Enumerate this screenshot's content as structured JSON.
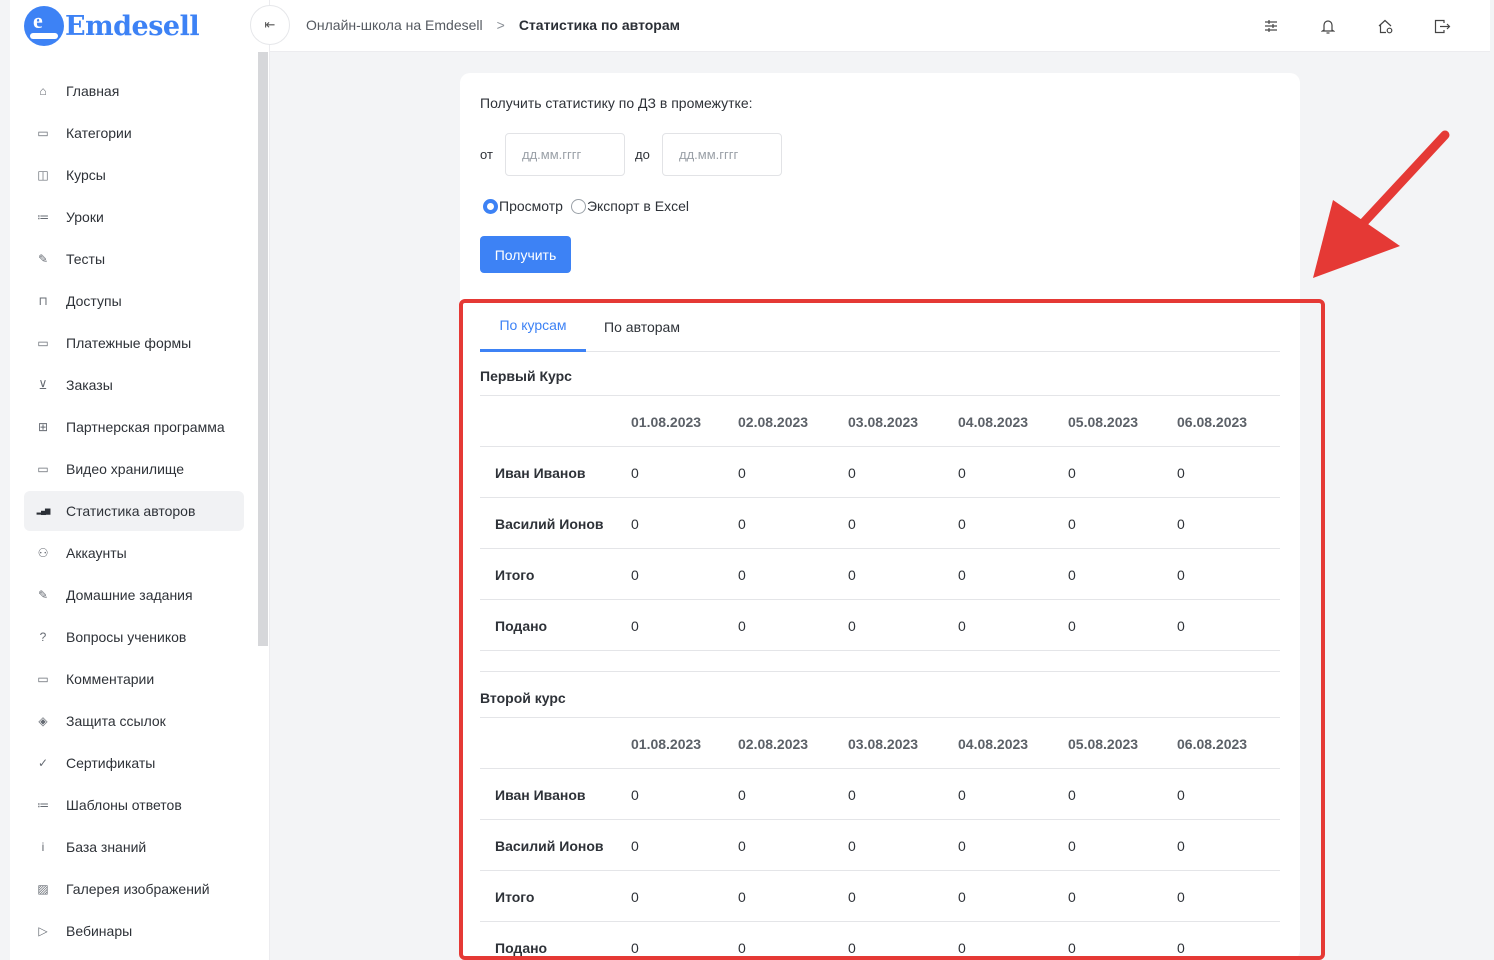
{
  "brand": {
    "name": "Emdesell",
    "mark": "e",
    "color": "#3d82f5"
  },
  "sidebar": {
    "items": [
      {
        "label": "Главная",
        "icon": "home-icon",
        "glyph": "⌂"
      },
      {
        "label": "Категории",
        "icon": "folder-icon",
        "glyph": "▭"
      },
      {
        "label": "Курсы",
        "icon": "book-icon",
        "glyph": "◫"
      },
      {
        "label": "Уроки",
        "icon": "list-icon",
        "glyph": "≔"
      },
      {
        "label": "Тесты",
        "icon": "edit-icon",
        "glyph": "✎"
      },
      {
        "label": "Доступы",
        "icon": "lock-icon",
        "glyph": "⊓"
      },
      {
        "label": "Платежные формы",
        "icon": "credit-card-icon",
        "glyph": "▭"
      },
      {
        "label": "Заказы",
        "icon": "cart-icon",
        "glyph": "⊻"
      },
      {
        "label": "Партнерская программа",
        "icon": "gift-icon",
        "glyph": "⊞"
      },
      {
        "label": "Видео хранилище",
        "icon": "video-icon",
        "glyph": "▭"
      },
      {
        "label": "Статистика авторов",
        "icon": "bar-chart-icon",
        "glyph": "▂▄▆"
      },
      {
        "label": "Аккаунты",
        "icon": "users-icon",
        "glyph": "⚇"
      },
      {
        "label": "Домашние задания",
        "icon": "pencil-icon",
        "glyph": "✎"
      },
      {
        "label": "Вопросы учеников",
        "icon": "question-icon",
        "glyph": "?"
      },
      {
        "label": "Комментарии",
        "icon": "comment-icon",
        "glyph": "▭"
      },
      {
        "label": "Защита ссылок",
        "icon": "shield-icon",
        "glyph": "◈"
      },
      {
        "label": "Сертификаты",
        "icon": "check-circle-icon",
        "glyph": "✓"
      },
      {
        "label": "Шаблоны ответов",
        "icon": "list-icon",
        "glyph": "≔"
      },
      {
        "label": "База знаний",
        "icon": "info-icon",
        "glyph": "i"
      },
      {
        "label": "Галерея изображений",
        "icon": "image-icon",
        "glyph": "▨"
      },
      {
        "label": "Вебинары",
        "icon": "play-icon",
        "glyph": "▷"
      }
    ],
    "active_index": 10
  },
  "breadcrumb": {
    "parent": "Онлайн-школа на Emdesell",
    "separator": ">",
    "current": "Статистика по авторам"
  },
  "topbar": {
    "collapse_glyph": "⇤",
    "icons": [
      "sliders-icon",
      "bell-icon",
      "home-settings-icon",
      "logout-icon"
    ]
  },
  "filter": {
    "title": "Получить статистику по ДЗ в промежутке:",
    "from_label": "от",
    "to_label": "до",
    "date_placeholder": "дд.мм.гггг",
    "radio_view": "Просмотр",
    "radio_export": "Экспорт в Excel",
    "selected": "view",
    "submit": "Получить"
  },
  "tabs": [
    {
      "label": "По курсам",
      "active": true
    },
    {
      "label": "По авторам",
      "active": false
    }
  ],
  "courses": [
    {
      "title": "Первый Курс",
      "dates": [
        "01.08.2023",
        "02.08.2023",
        "03.08.2023",
        "04.08.2023",
        "05.08.2023",
        "06.08.2023"
      ],
      "rows": [
        {
          "name": "Иван Иванов",
          "values": [
            "0",
            "0",
            "0",
            "0",
            "0",
            "0"
          ]
        },
        {
          "name": "Василий Ионов",
          "values": [
            "0",
            "0",
            "0",
            "0",
            "0",
            "0"
          ]
        },
        {
          "name": "Итого",
          "values": [
            "0",
            "0",
            "0",
            "0",
            "0",
            "0"
          ]
        },
        {
          "name": "Подано",
          "values": [
            "0",
            "0",
            "0",
            "0",
            "0",
            "0"
          ]
        }
      ]
    },
    {
      "title": "Второй курс",
      "dates": [
        "01.08.2023",
        "02.08.2023",
        "03.08.2023",
        "04.08.2023",
        "05.08.2023",
        "06.08.2023"
      ],
      "rows": [
        {
          "name": "Иван Иванов",
          "values": [
            "0",
            "0",
            "0",
            "0",
            "0",
            "0"
          ]
        },
        {
          "name": "Василий Ионов",
          "values": [
            "0",
            "0",
            "0",
            "0",
            "0",
            "0"
          ]
        },
        {
          "name": "Итого",
          "values": [
            "0",
            "0",
            "0",
            "0",
            "0",
            "0"
          ]
        },
        {
          "name": "Подано",
          "values": [
            "0",
            "0",
            "0",
            "0",
            "0",
            "0"
          ]
        }
      ]
    }
  ],
  "annotation": {
    "color": "#e53935"
  }
}
